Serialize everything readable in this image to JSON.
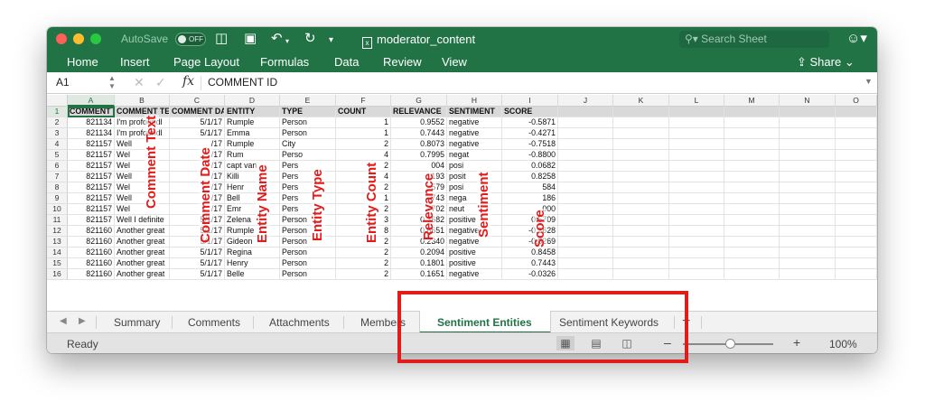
{
  "titlebar": {
    "autosave_label": "AutoSave",
    "autosave_state": "OFF",
    "doc_title": "moderator_content",
    "search_placeholder": "Search Sheet"
  },
  "ribbon": {
    "tabs": [
      "Home",
      "Insert",
      "Page Layout",
      "Formulas",
      "Data",
      "Review",
      "View"
    ],
    "share_label": "Share"
  },
  "formula_bar": {
    "cell_ref": "A1",
    "fx": "fx",
    "content": "COMMENT ID"
  },
  "grid": {
    "columns": [
      "A",
      "B",
      "C",
      "D",
      "E",
      "F",
      "G",
      "H",
      "I",
      "J",
      "K",
      "L",
      "M",
      "N",
      "O"
    ],
    "row_numbers": [
      "1",
      "2",
      "3",
      "4",
      "5",
      "6",
      "7",
      "8",
      "9",
      "10",
      "11",
      "12",
      "13",
      "14",
      "15",
      "16"
    ],
    "header_row": [
      "COMMENT ID",
      "COMMENT TE",
      "COMMENT DA",
      "ENTITY",
      "TYPE",
      "COUNT",
      "RELEVANCE",
      "SENTIMENT",
      "SCORE"
    ],
    "rows": [
      [
        "821134",
        "I'm profoundl",
        "5/1/17",
        "Rumple",
        "Person",
        "1",
        "0.9552",
        "negative",
        "-0.5871"
      ],
      [
        "821134",
        "I'm profoundl",
        "5/1/17",
        "Emma",
        "Person",
        "1",
        "0.7443",
        "negative",
        "-0.4271"
      ],
      [
        "821157",
        "Well",
        "/17",
        "Rumple",
        "City",
        "2",
        "0.8073",
        "negative",
        "-0.7518"
      ],
      [
        "821157",
        "Wel",
        "/17",
        "Rum",
        "Perso",
        "4",
        "0.7995",
        "negat",
        "-0.8800"
      ],
      [
        "821157",
        "Wel",
        "/17",
        "capt   van",
        "Pers",
        "2",
        "004",
        "posi",
        "0.0682"
      ],
      [
        "821157",
        "Well",
        "/17",
        "Killi",
        "Pers",
        "4",
        "193",
        "posit",
        "0.8258"
      ],
      [
        "821157",
        "Wel",
        "/17",
        "Henr",
        "Pers",
        "2",
        "579",
        "posi",
        "584"
      ],
      [
        "821157",
        "Well",
        "/17",
        "Bell",
        "Pers",
        "1",
        "743",
        "nega",
        "186"
      ],
      [
        "821157",
        "Wel",
        "/17",
        "Emr",
        "Pers",
        "2",
        "702",
        "neut",
        "000"
      ],
      [
        "821157",
        "Well I definite",
        "5/1/17",
        "Zelena",
        "Person",
        "3",
        "0.3682",
        "positive",
        "0.5709"
      ],
      [
        "821160",
        "Another great",
        "5/1/17",
        "Rumple",
        "Person",
        "8",
        "0.8651",
        "negative",
        "-0.1628"
      ],
      [
        "821160",
        "Another great",
        "5/1/17",
        "Gideon",
        "Person",
        "2",
        "0.2340",
        "negative",
        "-0.8269"
      ],
      [
        "821160",
        "Another great",
        "5/1/17",
        "Regina",
        "Person",
        "2",
        "0.2094",
        "positive",
        "0.8458"
      ],
      [
        "821160",
        "Another great",
        "5/1/17",
        "Henry",
        "Person",
        "2",
        "0.1801",
        "positive",
        "0.7443"
      ],
      [
        "821160",
        "Another great",
        "5/1/17",
        "Belle",
        "Person",
        "2",
        "0.1651",
        "negative",
        "-0.0326"
      ]
    ]
  },
  "annotations": {
    "comment_text": "Comment Text",
    "comment_date": "Comment Date",
    "entity_name": "Entity Name",
    "entity_type": "Entity Type",
    "entity_count": "Entity Count",
    "relevance": "Relevance",
    "sentiment": "Sentiment",
    "score": "Score"
  },
  "sheet_tabs": {
    "tabs": [
      "Summary",
      "Comments",
      "Attachments",
      "Members",
      "Sentiment Entities",
      "Sentiment Keywords"
    ],
    "active": "Sentiment Entities",
    "add_label": "+"
  },
  "status_bar": {
    "status": "Ready",
    "zoom_level": "100%",
    "zoom_minus": "–",
    "zoom_plus": "+"
  },
  "colors": {
    "excel_green": "#217346",
    "highlight_red": "#e21b1b"
  }
}
